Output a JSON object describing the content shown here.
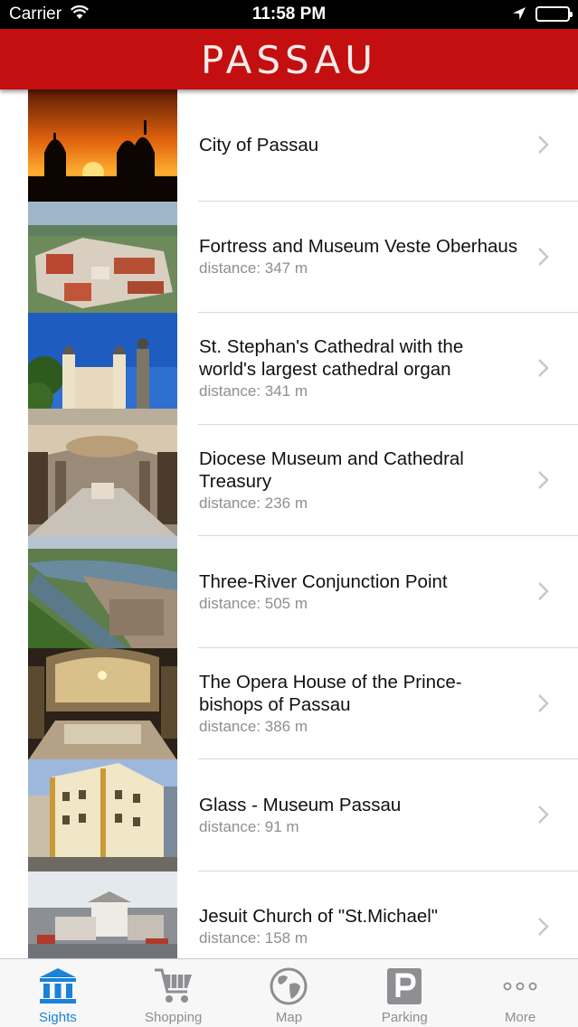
{
  "status_bar": {
    "carrier": "Carrier",
    "time": "11:58 PM"
  },
  "nav": {
    "title": "PASSAU"
  },
  "sights": [
    {
      "title": "City of Passau",
      "distance": ""
    },
    {
      "title": "Fortress and Museum Veste Oberhaus",
      "distance": "distance: 347 m"
    },
    {
      "title": "St. Stephan's Cathedral with the world's largest cathedral organ",
      "distance": "distance: 341 m"
    },
    {
      "title": "Diocese Museum and Cathedral Treasury",
      "distance": "distance: 236 m"
    },
    {
      "title": "Three-River Conjunction Point",
      "distance": "distance: 505 m"
    },
    {
      "title": "The Opera House of the Prince-bishops of Passau",
      "distance": "distance: 386 m"
    },
    {
      "title": "Glass - Museum Passau",
      "distance": "distance: 91 m"
    },
    {
      "title": "Jesuit Church of \"St.Michael\"",
      "distance": "distance: 158 m"
    }
  ],
  "tabs": [
    {
      "label": "Sights",
      "icon": "museum-icon",
      "active": true
    },
    {
      "label": "Shopping",
      "icon": "shopping-cart-icon",
      "active": false
    },
    {
      "label": "Map",
      "icon": "globe-icon",
      "active": false
    },
    {
      "label": "Parking",
      "icon": "parking-icon",
      "active": false
    },
    {
      "label": "More",
      "icon": "more-dots-icon",
      "active": false
    }
  ],
  "colors": {
    "nav_red": "#c30f0f",
    "active_tab": "#1a82d8",
    "inactive_tab": "#8e8e93",
    "distance_gray": "#8e8e93"
  }
}
